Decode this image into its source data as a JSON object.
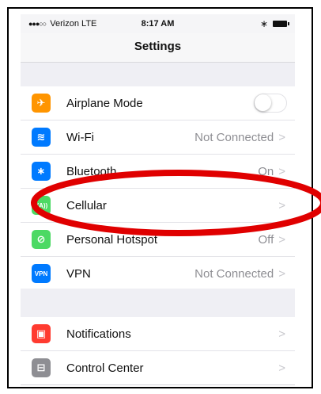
{
  "status_bar": {
    "signal": "●●●○○",
    "carrier": "Verizon",
    "network": "LTE",
    "time": "8:17 AM",
    "bluetooth_glyph": "∗"
  },
  "nav": {
    "title": "Settings"
  },
  "group1": [
    {
      "label": "Airplane Mode",
      "icon": "airplane-icon",
      "icon_glyph": "✈",
      "color": "#ff9500",
      "toggle": false
    },
    {
      "label": "Wi-Fi",
      "icon": "wifi-icon",
      "icon_glyph": "≋",
      "color": "#007aff",
      "value": "Not Connected"
    },
    {
      "label": "Bluetooth",
      "icon": "bluetooth-icon",
      "icon_glyph": "∗",
      "color": "#007aff",
      "value": "On"
    },
    {
      "label": "Cellular",
      "icon": "cellular-icon",
      "icon_glyph": "((A))",
      "color": "#4cd964",
      "value": ""
    },
    {
      "label": "Personal Hotspot",
      "icon": "hotspot-icon",
      "icon_glyph": "⊘",
      "color": "#4cd964",
      "value": "Off"
    },
    {
      "label": "VPN",
      "icon": "vpn-icon",
      "icon_glyph": "VPN",
      "color": "#007aff",
      "value": "Not Connected"
    }
  ],
  "group2": [
    {
      "label": "Notifications",
      "icon": "notifications-icon",
      "icon_glyph": "▣",
      "color": "#ff3b30",
      "value": ""
    },
    {
      "label": "Control Center",
      "icon": "control-center-icon",
      "icon_glyph": "⊟",
      "color": "#8e8e93",
      "value": ""
    }
  ],
  "chevron": ">",
  "annotation_color": "#e00000"
}
